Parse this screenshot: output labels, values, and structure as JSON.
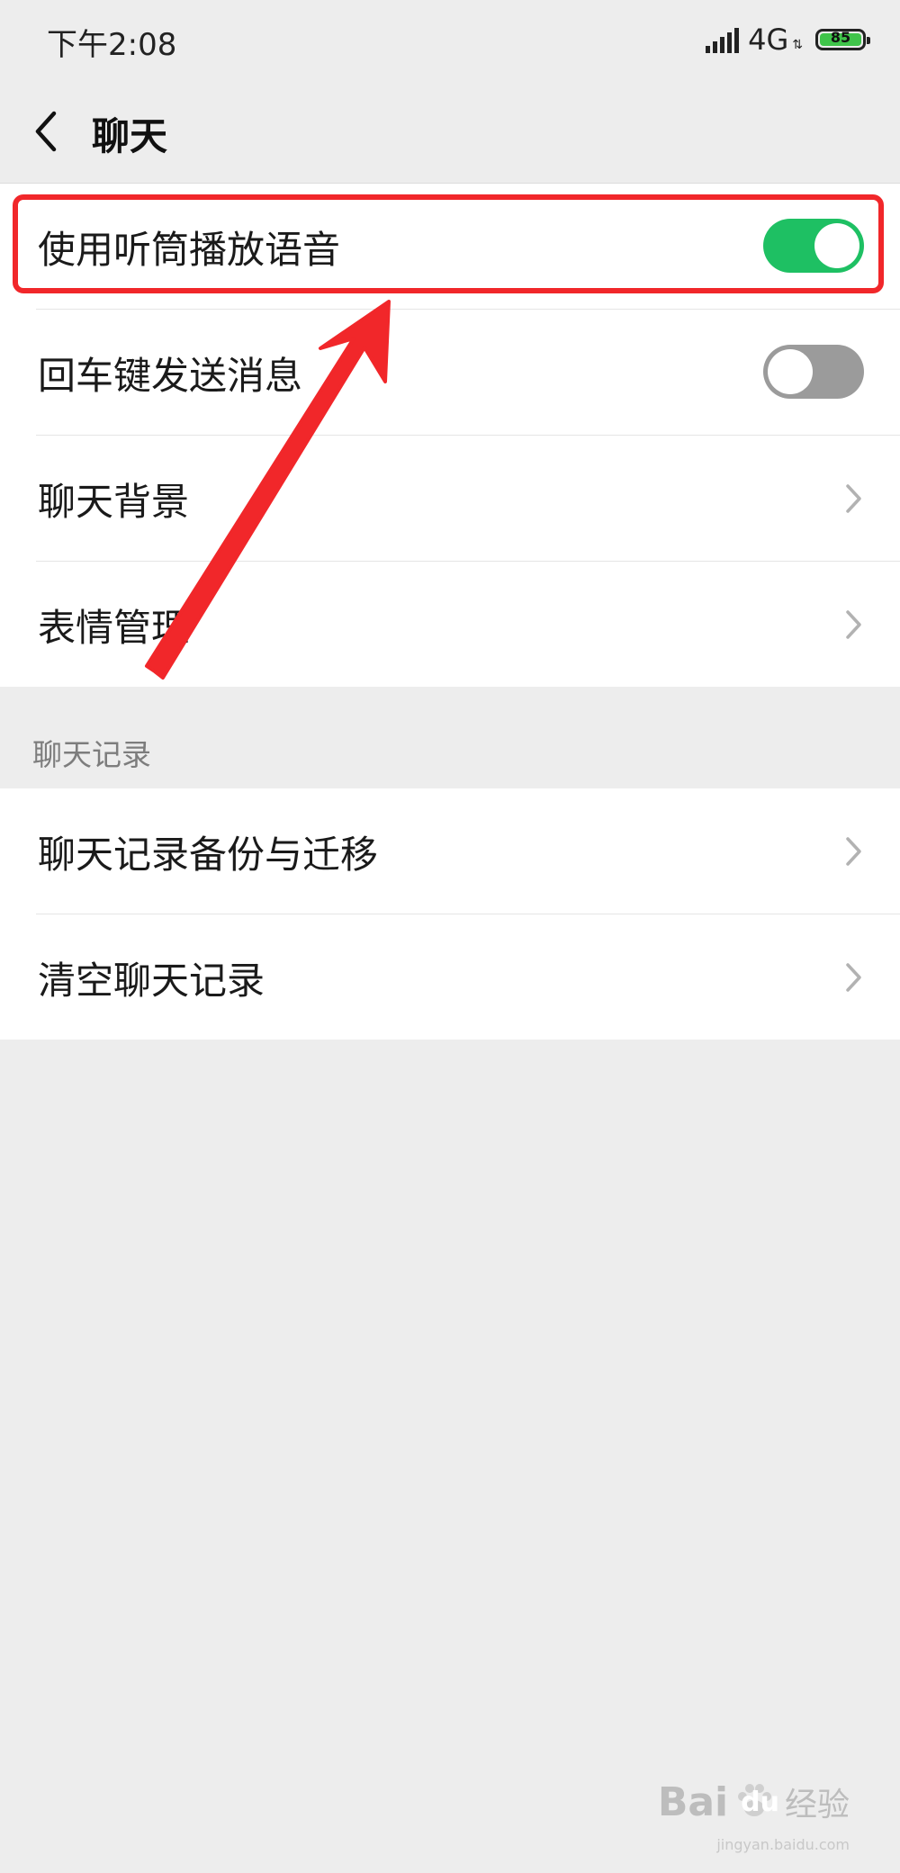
{
  "status_bar": {
    "time": "下午2:08",
    "network": "4G",
    "battery": "85",
    "battery_color": "#3fc44a"
  },
  "nav": {
    "title": "聊天",
    "back_icon": "chevron-left-icon"
  },
  "settings": {
    "group1": [
      {
        "label": "使用听筒播放语音",
        "control": "toggle",
        "state": "on"
      },
      {
        "label": "回车键发送消息",
        "control": "toggle",
        "state": "off"
      },
      {
        "label": "聊天背景",
        "control": "chevron"
      },
      {
        "label": "表情管理",
        "control": "chevron"
      }
    ],
    "section_header": "聊天记录",
    "group2": [
      {
        "label": "聊天记录备份与迁移",
        "control": "chevron"
      },
      {
        "label": "清空聊天记录",
        "control": "chevron"
      }
    ]
  },
  "colors": {
    "toggle_on": "#1ec063",
    "toggle_off": "#9b9b9b",
    "annotation_red": "#f1272a",
    "background": "#ededed"
  },
  "watermark": {
    "brand": "Bai",
    "brand_suffix": "du",
    "product": "经验",
    "url": "jingyan.baidu.com"
  }
}
